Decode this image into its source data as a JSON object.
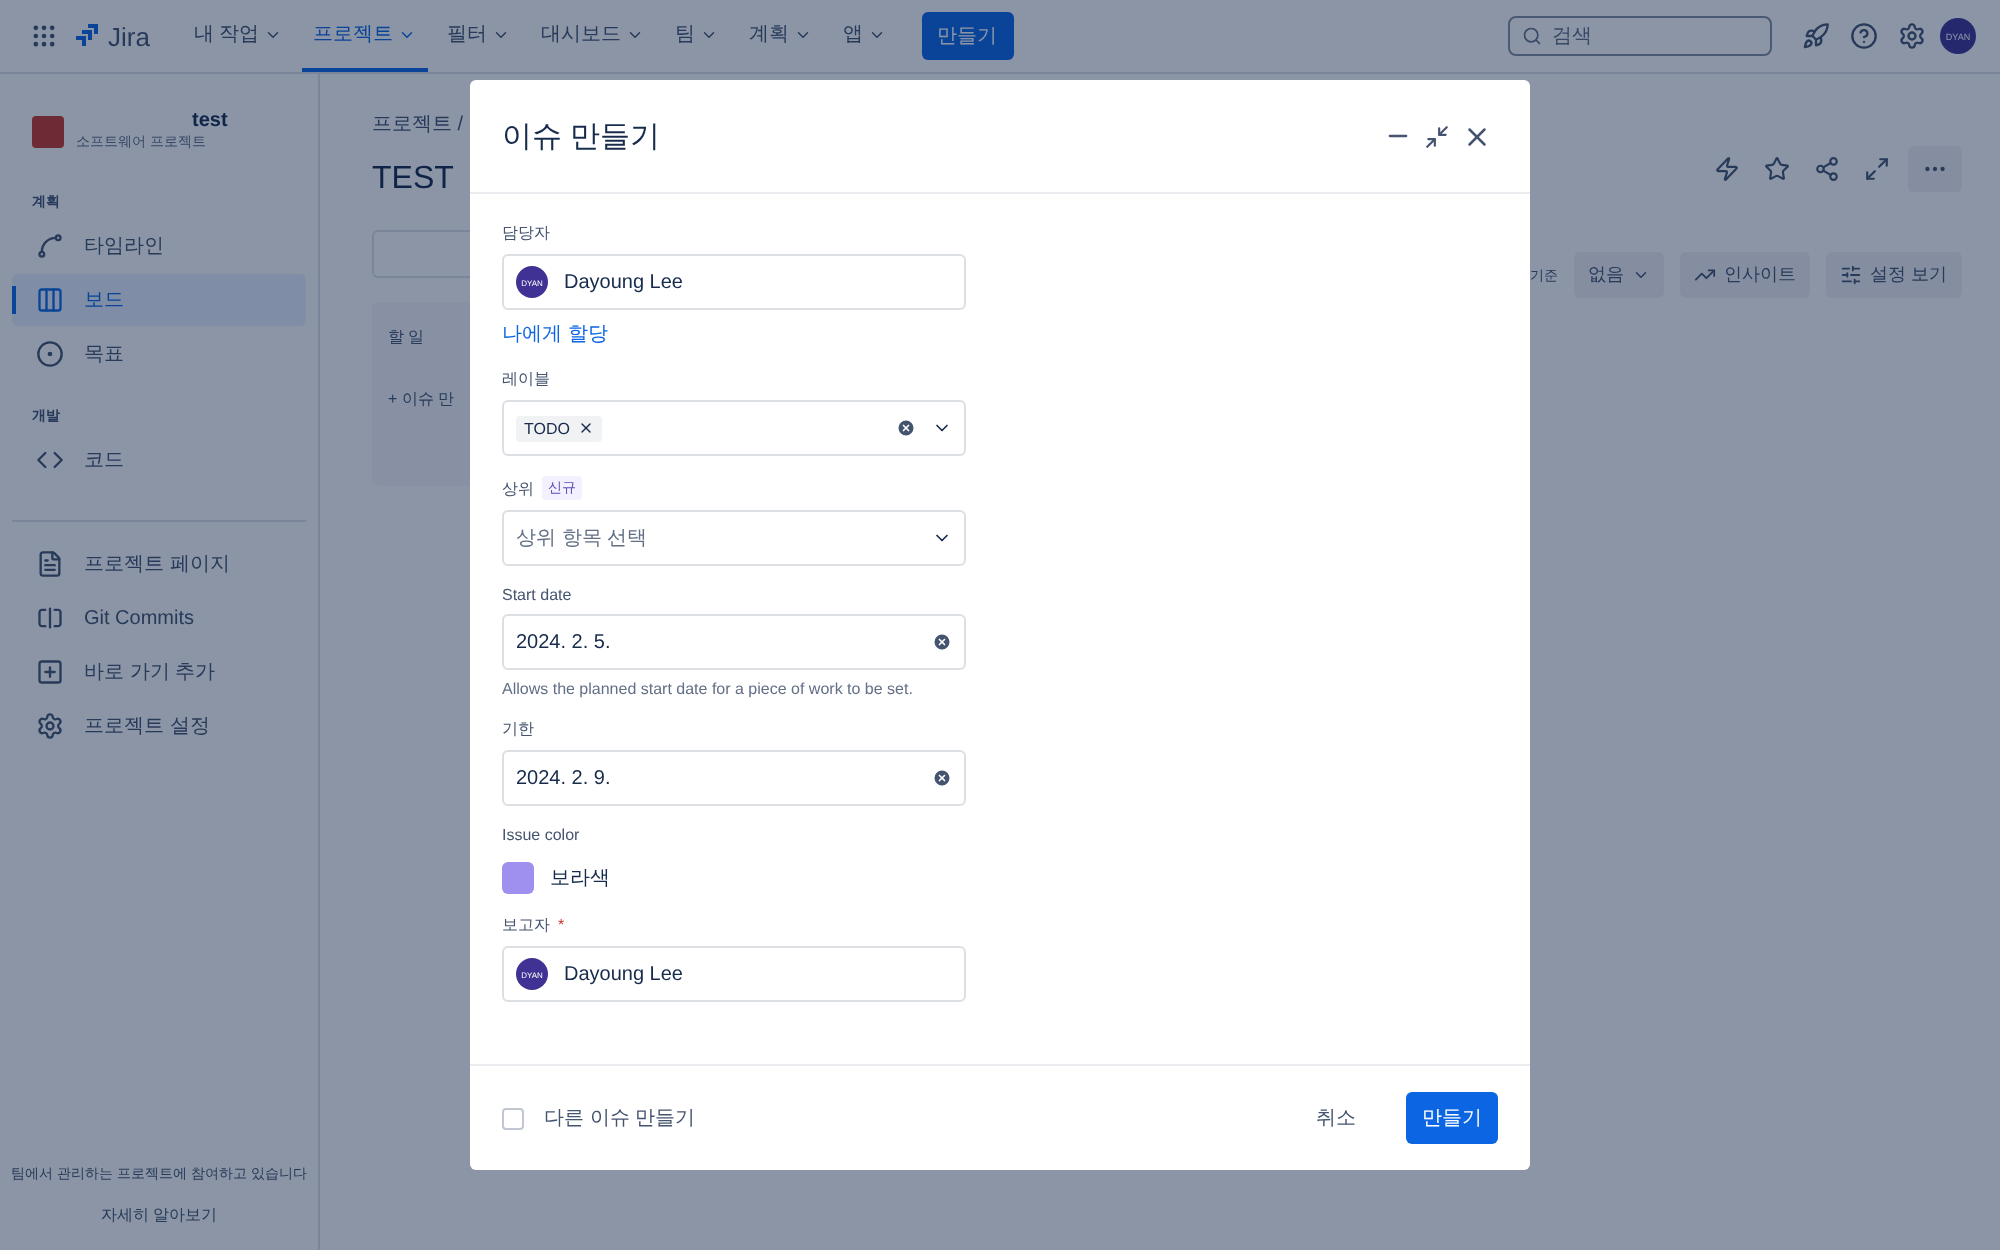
{
  "top_nav": {
    "product": "Jira",
    "items": [
      {
        "label": "내 작업",
        "selected": false
      },
      {
        "label": "프로젝트",
        "selected": true
      },
      {
        "label": "필터",
        "selected": false
      },
      {
        "label": "대시보드",
        "selected": false
      },
      {
        "label": "팀",
        "selected": false
      },
      {
        "label": "계획",
        "selected": false
      },
      {
        "label": "앱",
        "selected": false
      }
    ],
    "create_button": "만들기",
    "search": {
      "placeholder": "검색"
    },
    "avatar": "DYAN"
  },
  "sidebar": {
    "project": {
      "name": "test",
      "type": "소프트웨어 프로젝트"
    },
    "sections": [
      {
        "heading": "계획",
        "items": [
          {
            "label": "타임라인",
            "selected": false
          },
          {
            "label": "보드",
            "selected": true
          },
          {
            "label": "목표",
            "selected": false
          }
        ]
      },
      {
        "heading": "개발",
        "items": [
          {
            "label": "코드",
            "selected": false
          }
        ]
      }
    ],
    "links": [
      {
        "label": "프로젝트 페이지"
      },
      {
        "label": "Git Commits"
      },
      {
        "label": "바로 가기 추가"
      },
      {
        "label": "프로젝트 설정"
      }
    ],
    "footer": {
      "text": "팀에서 관리하는 프로젝트에 참여하고 있습니다",
      "link": "자세히 알아보기"
    }
  },
  "board": {
    "breadcrumb": "프로젝트 /",
    "title": "TEST",
    "column": "할 일",
    "add_issue": "+ 이슈 만",
    "group_label": "기준",
    "group_value": "없음",
    "insights": "인사이트",
    "view_settings": "설정 보기"
  },
  "modal": {
    "title": "이슈 만들기",
    "required_mark": "*",
    "fields": [
      {
        "kind": "user",
        "label": "담당자",
        "required": false,
        "avatar": "DYAN",
        "value": "Dayoung Lee",
        "link": "나에게 할당"
      },
      {
        "kind": "tags",
        "label": "레이블",
        "required": false,
        "tags": [
          "TODO"
        ]
      },
      {
        "kind": "select",
        "label": "상위",
        "required": false,
        "badge": "신규",
        "placeholder": "상위 항목 선택"
      },
      {
        "kind": "date",
        "label": "Start date",
        "required": false,
        "value": "2024. 2. 5.",
        "help": "Allows the planned start date for a piece of work to be set."
      },
      {
        "kind": "date",
        "label": "기한",
        "required": false,
        "value": "2024. 2. 9."
      },
      {
        "kind": "color",
        "label": "Issue color",
        "required": false,
        "color": "#9f8fef",
        "value": "보라색"
      },
      {
        "kind": "user",
        "label": "보고자",
        "required": true,
        "avatar": "DYAN",
        "value": "Dayoung Lee"
      }
    ],
    "create_another": {
      "label": "다른 이슈 만들기",
      "checked": false
    },
    "cancel": "취소",
    "submit": "만들기"
  }
}
